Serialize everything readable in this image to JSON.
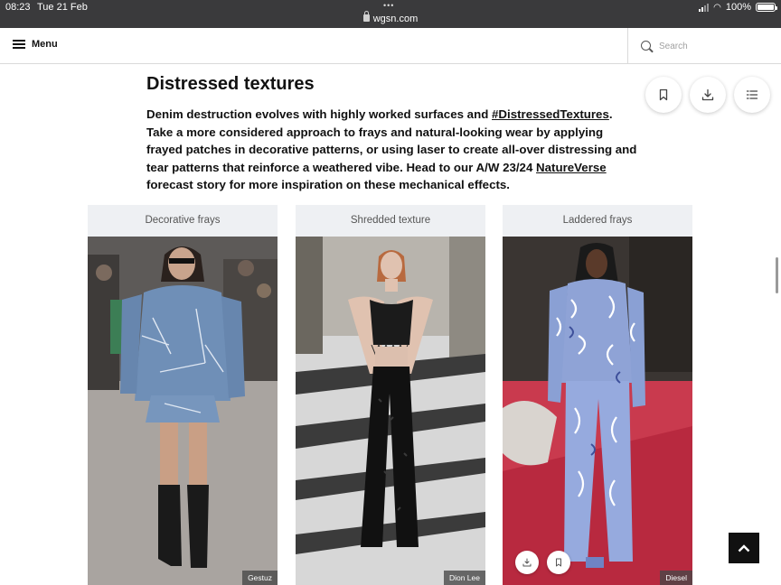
{
  "status_bar": {
    "time": "08:23",
    "date": "Tue 21 Feb",
    "dots": "•••",
    "url": "wgsn.com",
    "battery": "100%",
    "battery_level": 1.0
  },
  "header": {
    "menu_label": "Menu",
    "search_placeholder": "Search"
  },
  "article": {
    "title": "Distressed textures",
    "intro": {
      "part1": "Denim destruction evolves with highly worked surfaces and ",
      "link1": "#DistressedTextures",
      "part2": ". Take a more considered approach to frays and natural-looking wear by applying frayed patches in decorative patterns, or using laser to create all-over distressing and tear patterns that reinforce a weathered vibe. Head to our A/W 23/24 ",
      "link2": "NatureVerse",
      "part3": " forecast story for more inspiration on these mechanical effects."
    }
  },
  "actions": {
    "icons": [
      "bookmark-icon",
      "download-icon",
      "list-icon"
    ]
  },
  "cards": [
    {
      "title": "Decorative frays",
      "credit": "Gestuz"
    },
    {
      "title": "Shredded texture",
      "credit": "Dion Lee"
    },
    {
      "title": "Laddered frays",
      "credit": "Diesel"
    }
  ],
  "colors": {
    "status_bar": "#3a3a3c",
    "text": "#111111",
    "card_bg": "#eef0f3",
    "denim": "#6f8fb7",
    "runway_red": "#b8293f"
  }
}
